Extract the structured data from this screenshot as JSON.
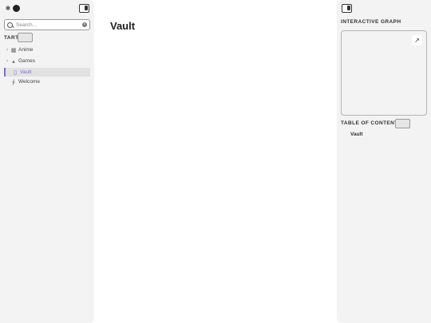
{
  "left_sidebar": {
    "search": {
      "placeholder": "Search...",
      "clear_icon": "x-circle-icon"
    },
    "section_title": "TART",
    "tree": [
      {
        "label": "Anime",
        "icon": "book-icon",
        "expandable": true
      },
      {
        "label": "Games",
        "icon": "gamepad-icon",
        "expandable": true
      },
      {
        "label": "Vault",
        "icon": "file-icon",
        "expandable": false,
        "active": true
      },
      {
        "label": "Welcome",
        "icon": "paperclip-icon",
        "expandable": false
      }
    ]
  },
  "main": {
    "title": "Vault"
  },
  "right_sidebar": {
    "graph_title": "INTERACTIVE GRAPH",
    "toc_title": "TABLE OF CONTENTS",
    "toc_items": [
      "Vault"
    ]
  },
  "colors": {
    "accent": "#7b6cd9",
    "sidebar_bg": "#f3f3f3"
  }
}
